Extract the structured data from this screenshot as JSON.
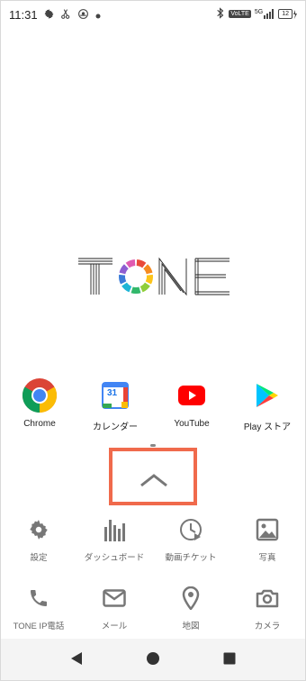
{
  "status_bar": {
    "time": "11:31",
    "icons": [
      "gear-icon",
      "scissors-icon",
      "sunset-icon",
      "dot-icon"
    ],
    "right_icons": [
      "bluetooth-icon",
      "volte-icon",
      "5g-signal-icon",
      "battery-icon"
    ],
    "volte": "VoLTE",
    "network": "5G",
    "battery": "12"
  },
  "brand": {
    "logo_text": "TONE",
    "ring_colors": [
      "#e94a3a",
      "#f58a20",
      "#fcc419",
      "#8fce3a",
      "#32b86b",
      "#1fb5d6",
      "#3b7bd8",
      "#8e5ed1",
      "#e05bb1"
    ]
  },
  "dock_apps": [
    {
      "label": "Chrome",
      "icon": "chrome-icon"
    },
    {
      "label": "カレンダー",
      "icon": "calendar-icon",
      "day": "31"
    },
    {
      "label": "YouTube",
      "icon": "youtube-icon"
    },
    {
      "label": "Play ストア",
      "icon": "play-store-icon"
    }
  ],
  "tools_row1": [
    {
      "label": "設定",
      "icon": "gear-icon"
    },
    {
      "label": "ダッシュボード",
      "icon": "dashboard-icon"
    },
    {
      "label": "動画チケット",
      "icon": "video-ticket-icon"
    },
    {
      "label": "写真",
      "icon": "photo-icon"
    }
  ],
  "tools_row2": [
    {
      "label": "TONE IP電話",
      "icon": "phone-icon"
    },
    {
      "label": "メール",
      "icon": "mail-icon"
    },
    {
      "label": "地図",
      "icon": "map-pin-icon"
    },
    {
      "label": "カメラ",
      "icon": "camera-icon"
    }
  ],
  "colors": {
    "highlight": "#f06a4c",
    "icon_gray": "#777777",
    "youtube_red": "#ff0000"
  }
}
